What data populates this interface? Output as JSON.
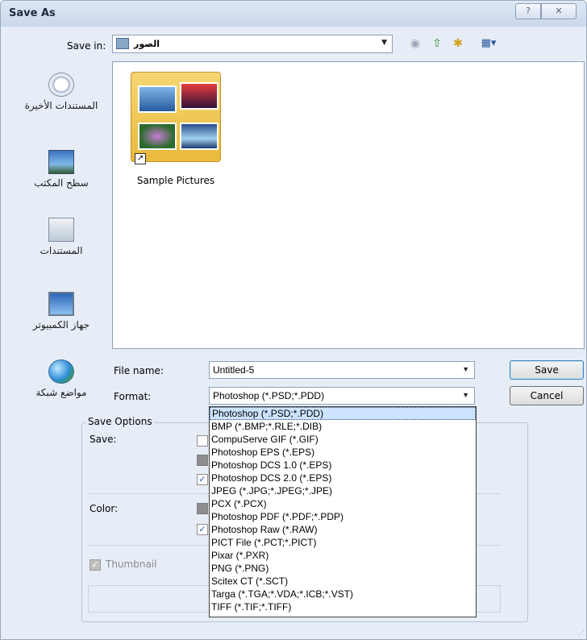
{
  "window": {
    "title": "Save As",
    "help_glyph": "?",
    "close_glyph": "✕"
  },
  "save_in": {
    "label": "Save in:",
    "value": "الصور"
  },
  "toolbar": {
    "back": "◉",
    "up": "⇧",
    "new_folder": "✱",
    "views": "▦▾"
  },
  "places": [
    {
      "label": "المستندات الأخيرة",
      "icon": "recent-icon"
    },
    {
      "label": "سطح المكتب",
      "icon": "desktop-icon"
    },
    {
      "label": "المستندات",
      "icon": "documents-icon"
    },
    {
      "label": "جهاز الكمبيوتر",
      "icon": "computer-icon"
    },
    {
      "label": "مواضع شبكة",
      "icon": "network-icon"
    }
  ],
  "files": [
    {
      "name": "Sample Pictures",
      "type": "folder"
    }
  ],
  "form": {
    "file_name_label": "File name:",
    "file_name_value": "Untitled-5",
    "format_label": "Format:",
    "format_value": "Photoshop (*.PSD;*.PDD)"
  },
  "buttons": {
    "save": "Save",
    "cancel": "Cancel"
  },
  "save_options": {
    "title": "Save Options",
    "save_label": "Save:",
    "color_label": "Color:",
    "thumbnail_label": "Thumbnail"
  },
  "format_options": [
    "Photoshop (*.PSD;*.PDD)",
    "BMP (*.BMP;*.RLE;*.DIB)",
    "CompuServe GIF (*.GIF)",
    "Photoshop EPS (*.EPS)",
    "Photoshop DCS 1.0 (*.EPS)",
    "Photoshop DCS 2.0 (*.EPS)",
    "JPEG (*.JPG;*.JPEG;*.JPE)",
    "PCX (*.PCX)",
    "Photoshop PDF (*.PDF;*.PDP)",
    "Photoshop Raw (*.RAW)",
    "PICT File (*.PCT;*.PICT)",
    "Pixar (*.PXR)",
    "PNG (*.PNG)",
    "Scitex CT (*.SCT)",
    "Targa (*.TGA;*.VDA;*.ICB;*.VST)",
    "TIFF (*.TIF;*.TIFF)"
  ],
  "colors": {
    "selection": "#cde4ff",
    "dialog_bg": "#e6edf6",
    "default_button_border": "#3c7fb1"
  }
}
